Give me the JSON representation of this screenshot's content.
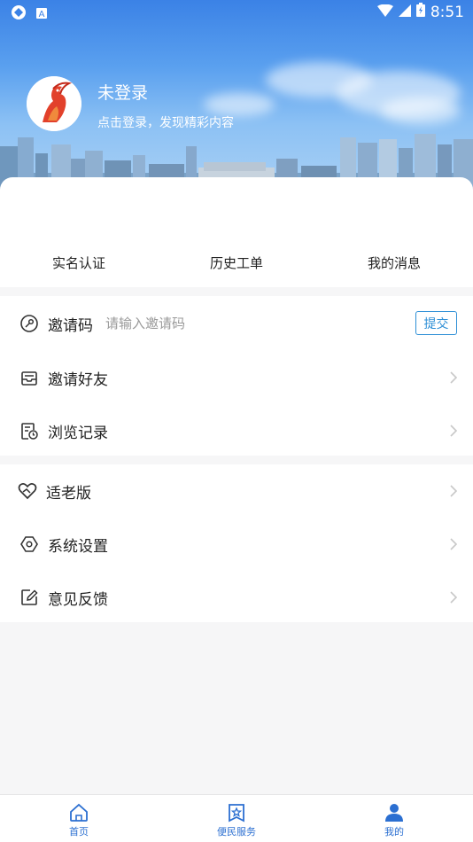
{
  "status_bar": {
    "time": "8:51"
  },
  "user": {
    "name": "未登录",
    "subtitle": "点击登录，发现精彩内容"
  },
  "quick_actions": [
    {
      "label": "实名认证"
    },
    {
      "label": "历史工单"
    },
    {
      "label": "我的消息"
    }
  ],
  "invite": {
    "label": "邀请码",
    "placeholder": "请输入邀请码",
    "submit": "提交"
  },
  "menu_group_1": [
    {
      "label": "邀请好友"
    },
    {
      "label": "浏览记录"
    }
  ],
  "menu_group_2": [
    {
      "label": "适老版"
    },
    {
      "label": "系统设置"
    },
    {
      "label": "意见反馈"
    }
  ],
  "bottom_nav": [
    {
      "label": "首页"
    },
    {
      "label": "便民服务"
    },
    {
      "label": "我的"
    }
  ],
  "colors": {
    "accent": "#2b6fd1",
    "submit_border": "#2e8fd6"
  }
}
